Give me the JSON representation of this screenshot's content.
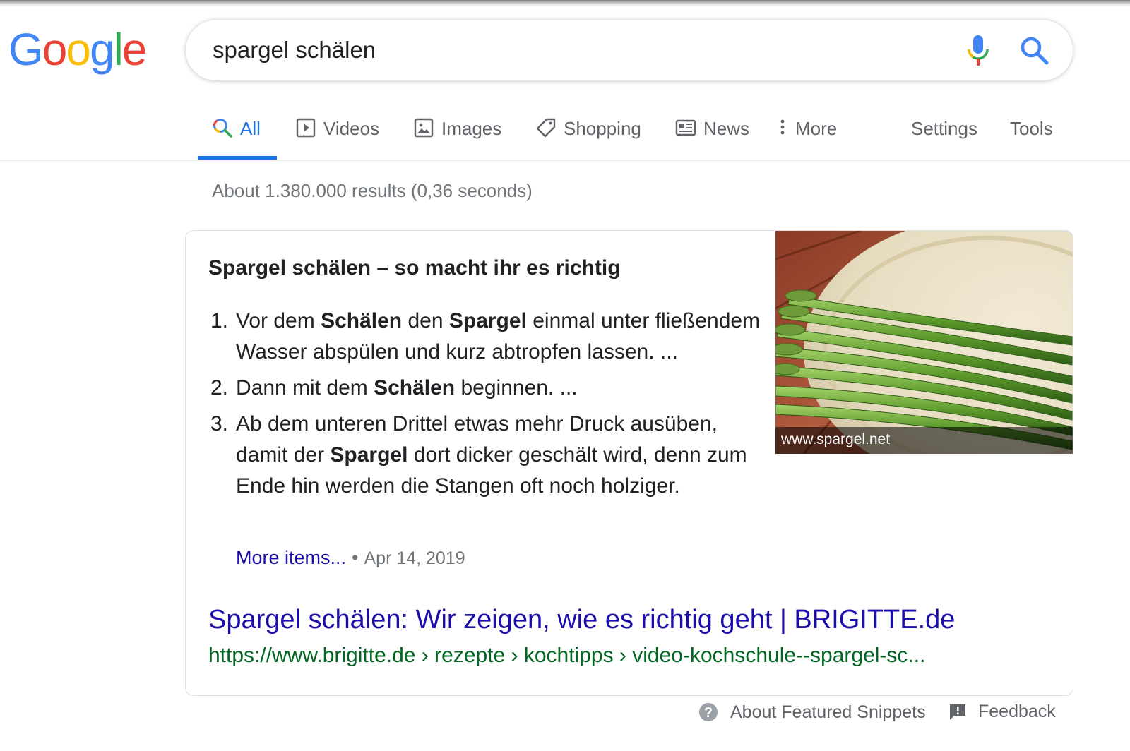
{
  "logo": {
    "letters": [
      "G",
      "o",
      "o",
      "g",
      "l",
      "e"
    ],
    "colors": [
      "#4285f4",
      "#ea4335",
      "#fbbc05",
      "#4285f4",
      "#34a853",
      "#ea4335"
    ]
  },
  "search": {
    "query": "spargel schälen",
    "mic_icon": "microphone-icon",
    "search_icon": "magnifier-icon"
  },
  "tabs": [
    {
      "label": "All",
      "icon": "search-icon",
      "active": true
    },
    {
      "label": "Videos",
      "icon": "play-icon",
      "active": false
    },
    {
      "label": "Images",
      "icon": "image-icon",
      "active": false
    },
    {
      "label": "Shopping",
      "icon": "tag-icon",
      "active": false
    },
    {
      "label": "News",
      "icon": "newspaper-icon",
      "active": false
    },
    {
      "label": "More",
      "icon": "vertical-dots-icon",
      "active": false
    }
  ],
  "tools": {
    "settings": "Settings",
    "tools": "Tools"
  },
  "result_stats": "About 1.380.000 results (0,36 seconds)",
  "snippet": {
    "title": "Spargel schälen – so macht ihr es richtig",
    "steps": [
      {
        "num": "1.",
        "parts": [
          {
            "t": "Vor dem ",
            "b": false
          },
          {
            "t": "Schälen",
            "b": true
          },
          {
            "t": " den ",
            "b": false
          },
          {
            "t": "Spargel",
            "b": true
          },
          {
            "t": " einmal unter fließendem Wasser abspülen und kurz abtropfen lassen. ...",
            "b": false
          }
        ]
      },
      {
        "num": "2.",
        "parts": [
          {
            "t": "Dann mit dem ",
            "b": false
          },
          {
            "t": "Schälen",
            "b": true
          },
          {
            "t": " beginnen. ...",
            "b": false
          }
        ]
      },
      {
        "num": "3.",
        "parts": [
          {
            "t": "Ab dem unteren Drittel etwas mehr Druck ausüben, damit der ",
            "b": false
          },
          {
            "t": "Spargel",
            "b": true
          },
          {
            "t": " dort dicker geschält wird, denn zum Ende hin werden die Stangen oft noch holziger.",
            "b": false
          }
        ]
      }
    ],
    "more_items": "More items...",
    "separator": "•",
    "date": "Apr 14, 2019",
    "image_caption": "www.spargel.net",
    "result_title": "Spargel schälen: Wir zeigen, wie es richtig geht | BRIGITTE.de",
    "result_url": "https://www.brigitte.de › rezepte › kochtipps › video-kochschule--spargel-sc..."
  },
  "footer": {
    "about": "About Featured Snippets",
    "about_icon": "help-circle-icon",
    "feedback": "Feedback",
    "feedback_icon": "feedback-flag-icon"
  },
  "colors": {
    "link": "#1a0dab",
    "url_green": "#006621",
    "active_tab": "#1a73e8",
    "muted": "#70757a"
  }
}
